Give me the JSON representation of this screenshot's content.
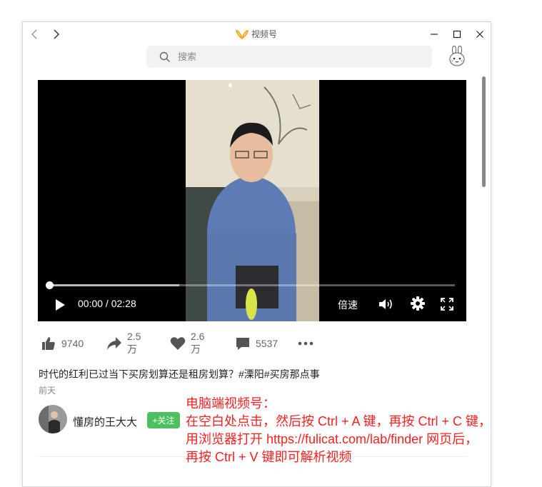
{
  "window": {
    "title": "视频号"
  },
  "search": {
    "placeholder": "搜索"
  },
  "player": {
    "current_time": "00:00",
    "separator": " / ",
    "duration": "02:28",
    "speed_label": "倍速",
    "progress_fraction": 0.0,
    "buffered_fraction": 0.32
  },
  "actions": {
    "likes": "9740",
    "shares": "2.5万",
    "hearts": "2.6万",
    "comments": "5537"
  },
  "post": {
    "description": "时代的红利已过当下买房划算还是租房划算？#溧阳#买房那点事",
    "date": "前天"
  },
  "author": {
    "name": "懂房的王大大",
    "follow_label": "+关注"
  },
  "overlay": {
    "lines": [
      "电脑端视频号：",
      "在空白处点击，然后按 Ctrl + A 键，再按 Ctrl + C 键，",
      "用浏览器打开 https://fulicat.com/lab/finder 网页后，",
      "再按 Ctrl + V 键即可解析视频"
    ]
  },
  "colors": {
    "follow_green": "#4cc05f",
    "overlay_red": "#ff1f1f",
    "logo_orange": "#f5a623",
    "player_bg": "#000000"
  },
  "icons": [
    "back-icon",
    "forward-icon",
    "app-logo-icon",
    "minimize-icon",
    "maximize-icon",
    "close-icon",
    "search-icon",
    "thumbs-up-icon",
    "share-icon",
    "heart-icon",
    "comment-icon",
    "more-icon",
    "play-icon",
    "volume-icon",
    "gear-icon",
    "fullscreen-icon"
  ]
}
